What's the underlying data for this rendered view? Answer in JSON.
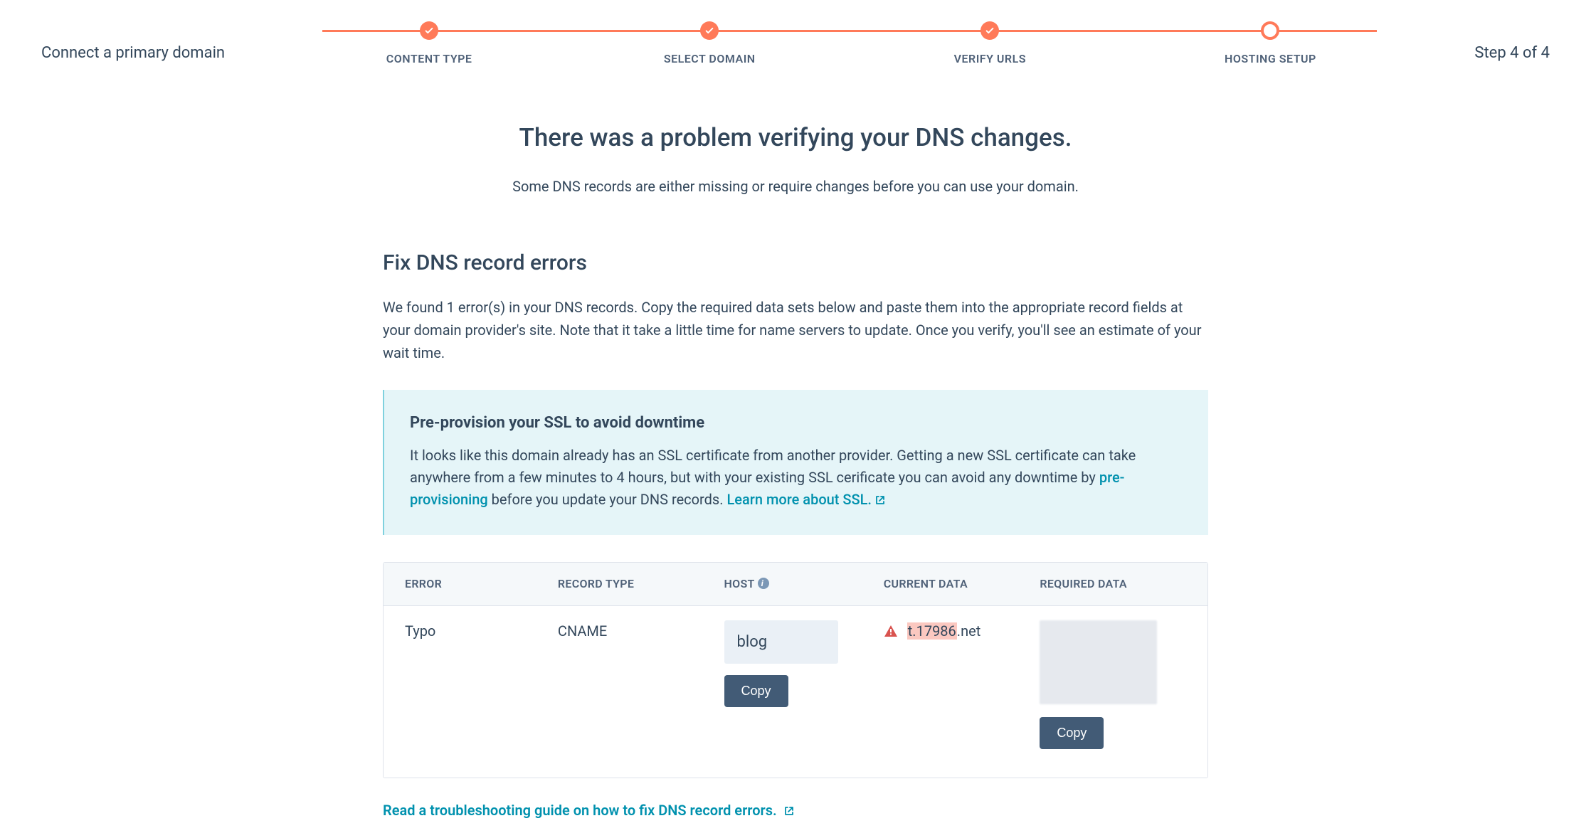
{
  "header": {
    "left": "Connect a primary domain",
    "right": "Step 4 of 4"
  },
  "stepper": {
    "steps": [
      {
        "label": "CONTENT TYPE",
        "state": "done"
      },
      {
        "label": "SELECT DOMAIN",
        "state": "done"
      },
      {
        "label": "VERIFY URLS",
        "state": "done"
      },
      {
        "label": "HOSTING SETUP",
        "state": "current"
      }
    ]
  },
  "headline": "There was a problem verifying your DNS changes.",
  "subhead": "Some DNS records are either missing or require changes before you can use your domain.",
  "section": {
    "title": "Fix DNS record errors",
    "desc": "We found 1 error(s) in your DNS records. Copy the required data sets below and paste them into the appropriate record fields at your domain provider's site. Note that it take a little time for name servers to update. Once you verify, you'll see an estimate of your wait time."
  },
  "info_panel": {
    "title": "Pre-provision your SSL to avoid downtime",
    "body_before": "It looks like this domain already has an SSL certificate from another provider. Getting a new SSL certificate can take anywhere from a few minutes to 4 hours, but with your existing SSL cerificate you can avoid any downtime by ",
    "link1": "pre-provisioning",
    "body_mid": " before you update your DNS records. ",
    "link2": "Learn more about SSL."
  },
  "table": {
    "headers": {
      "error": "ERROR",
      "record_type": "RECORD TYPE",
      "host": "HOST",
      "current_data": "CURRENT DATA",
      "required_data": "REQUIRED DATA"
    },
    "row": {
      "error": "Typo",
      "record_type": "CNAME",
      "host_value": "blog",
      "copy_label": "Copy",
      "current_highlight": "t.17986",
      "current_rest": ".net",
      "required_copy_label": "Copy"
    }
  },
  "footer_link": "Read a troubleshooting guide on how to fix DNS record errors."
}
